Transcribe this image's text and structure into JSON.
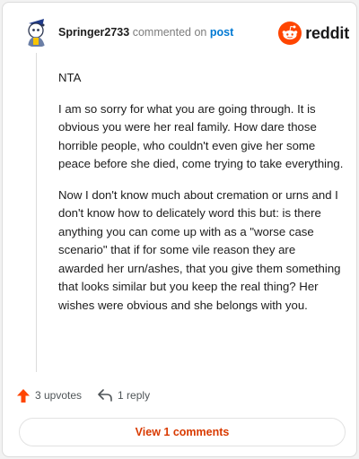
{
  "header": {
    "username": "Springer2733",
    "action_text": "commented on",
    "post_link": "post",
    "brand_wordmark": "reddit",
    "avatar_icon": "avatar-snoo-icon",
    "brand_icon": "reddit-snoo-icon"
  },
  "comment": {
    "paragraphs": [
      "NTA",
      "I am so sorry for what you are going through. It is obvious you were her real family. How dare those horrible people, who couldn't even give her some peace before she died, come trying to take everything.",
      "Now I don't know much about cremation or urns and I don't know how to delicately word this but: is there anything you can come up with as a \"worse case scenario\" that if for some vile reason they are awarded her urn/ashes, that you give them something that looks similar but you keep the real thing? Her wishes were obvious and she belongs with you."
    ]
  },
  "actions": {
    "upvotes": "3 upvotes",
    "replies": "1 reply",
    "upvote_icon": "upvote-arrow-icon",
    "reply_icon": "reply-arrow-icon"
  },
  "footer": {
    "view_comments": "View 1 comments"
  },
  "colors": {
    "brand_orange": "#ff4500",
    "link_blue": "#0079d3",
    "button_text": "#d93a00"
  }
}
